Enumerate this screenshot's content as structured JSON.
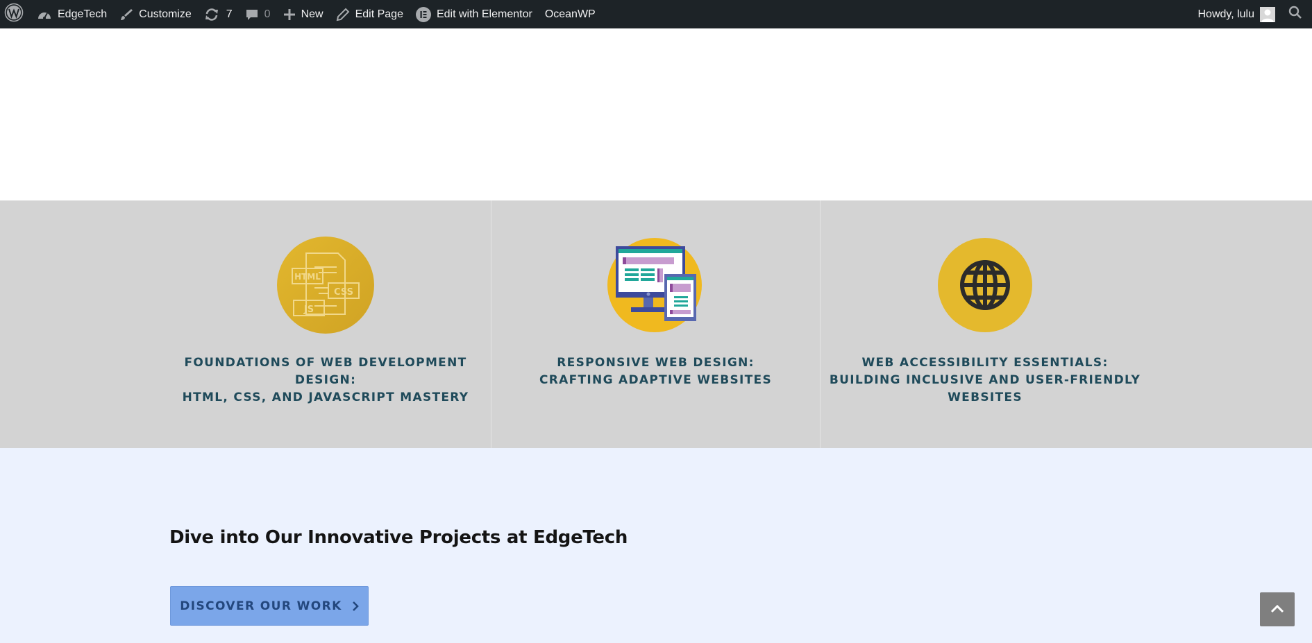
{
  "admin_bar": {
    "site_name": "EdgeTech",
    "customize_label": "Customize",
    "updates_count": "7",
    "comments_count": "0",
    "new_label": "New",
    "edit_page_label": "Edit Page",
    "elementor_label": "Edit with Elementor",
    "theme_label": "OceanWP",
    "greeting": "Howdy, lulu"
  },
  "features": [
    {
      "icon": "html-css-js-icon",
      "title_lines": [
        "FOUNDATIONS OF WEB DEVELOPMENT DESIGN:",
        "HTML, CSS, AND JAVASCRIPT MASTERY"
      ],
      "icon_labels": {
        "html": "HTML",
        "css": "CSS",
        "js": "JS"
      }
    },
    {
      "icon": "responsive-devices-icon",
      "title_lines": [
        "RESPONSIVE WEB DESIGN:",
        "CRAFTING ADAPTIVE WEBSITES"
      ]
    },
    {
      "icon": "globe-icon",
      "title_lines": [
        "WEB ACCESSIBILITY ESSENTIALS:",
        "BUILDING INCLUSIVE AND USER-FRIENDLY",
        "WEBSITES"
      ]
    }
  ],
  "cta": {
    "heading": "Dive into Our Innovative Projects at EdgeTech",
    "button_label": "DISCOVER OUR WORK"
  },
  "colors": {
    "admin_bar_bg": "#1d2327",
    "features_bg": "#d3d3d3",
    "feature_title": "#1f4a5a",
    "icon_gold": "#e2b72e",
    "cta_bg": "#ecf2fe",
    "cta_button_bg": "#7ba6e9",
    "cta_button_text": "#23477d",
    "scroll_top_bg": "#7f7f7f"
  }
}
